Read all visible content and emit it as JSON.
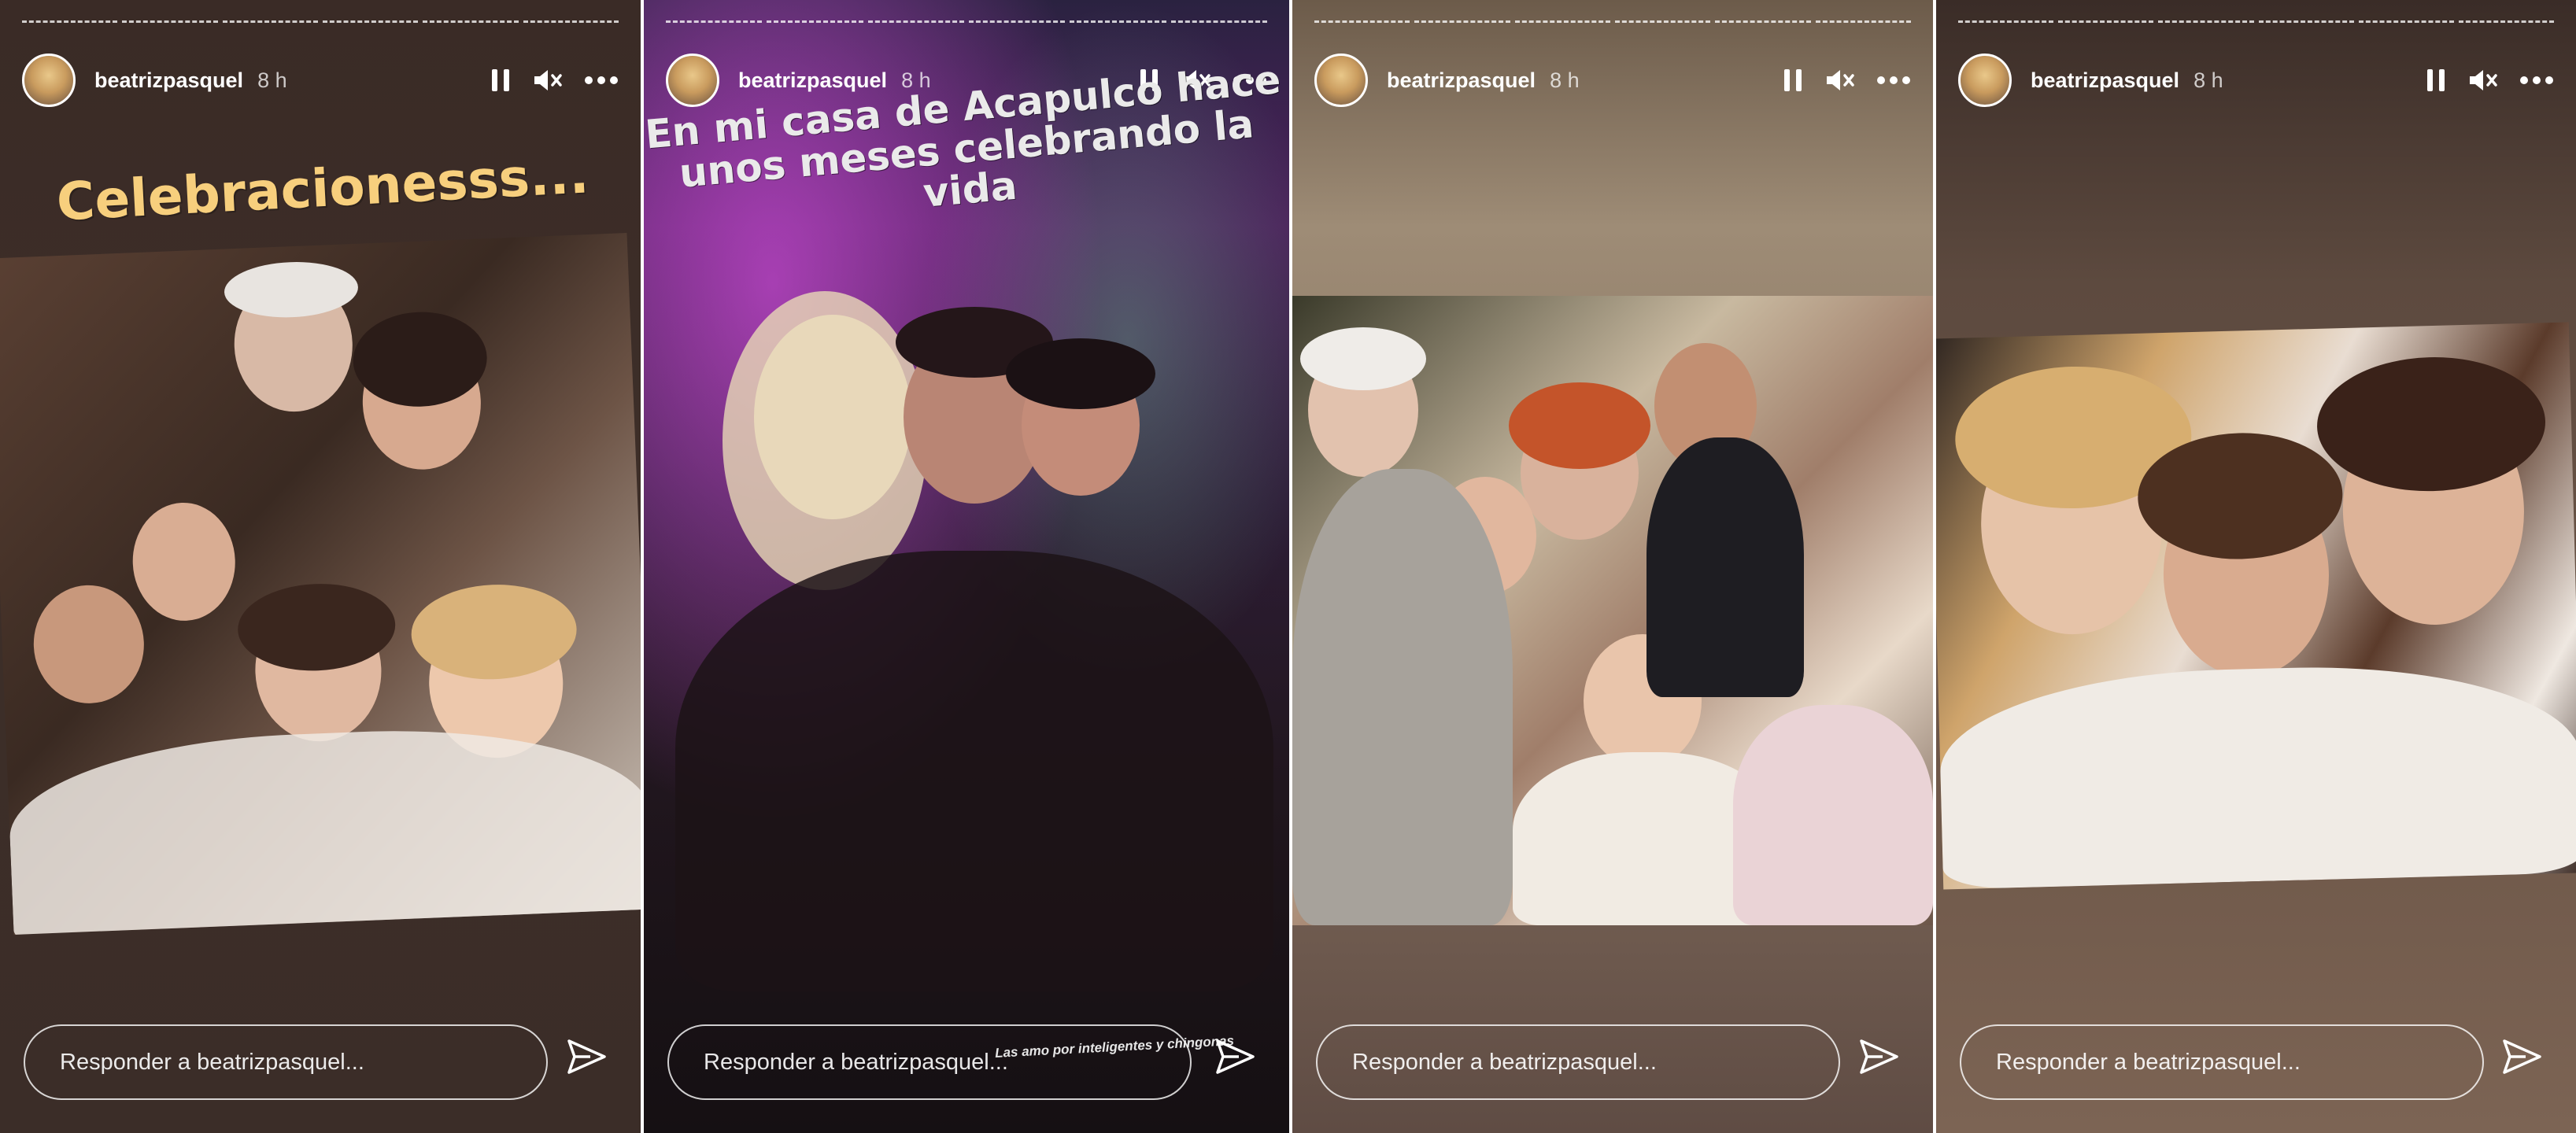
{
  "stories": [
    {
      "username": "beatrizpasquel",
      "time": "8 h",
      "caption": "Celebracionesss...",
      "reply_placeholder": "Responder a beatrizpasquel..."
    },
    {
      "username": "beatrizpasquel",
      "time": "8 h",
      "caption": "En mi casa de Acapulco hace unos meses celebrando la vida",
      "caption_small": "Las amo por inteligentes y chingonas",
      "reply_placeholder": "Responder a beatrizpasquel..."
    },
    {
      "username": "beatrizpasquel",
      "time": "8 h",
      "reply_placeholder": "Responder a beatrizpasquel..."
    },
    {
      "username": "beatrizpasquel",
      "time": "8 h",
      "reply_placeholder": "Responder a beatrizpasquel..."
    }
  ],
  "icons": {
    "pause": "pause-icon",
    "mute": "volume-mute-icon",
    "more": "more-horizontal-icon",
    "send": "send-icon"
  },
  "colors": {
    "caption_gold": "#f7cf7d",
    "text": "#ffffff"
  }
}
